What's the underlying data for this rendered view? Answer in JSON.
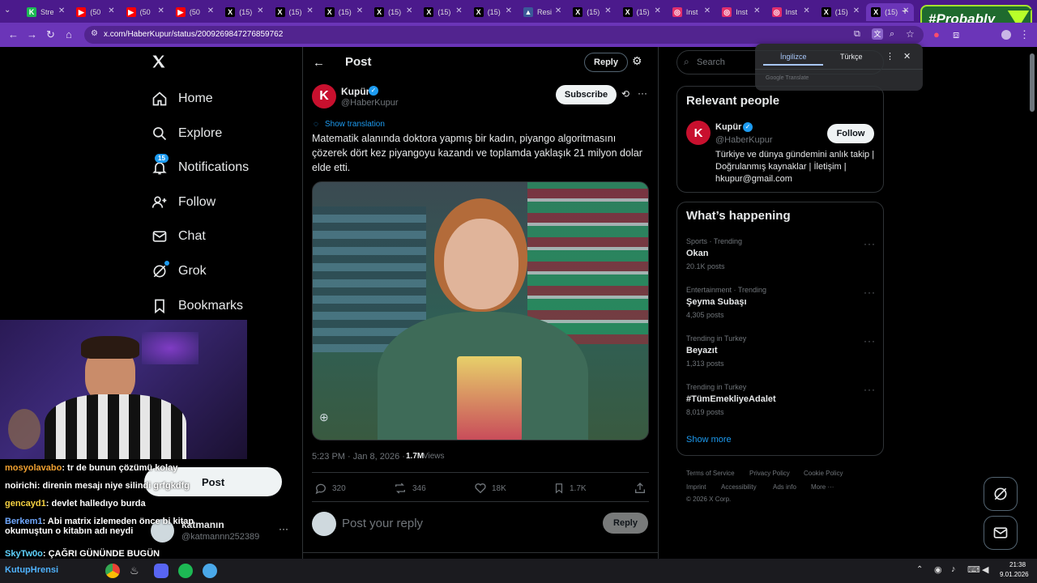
{
  "browser": {
    "tabs": [
      {
        "label": "Stre",
        "color": "#1db954",
        "glyph": "K"
      },
      {
        "label": "(50",
        "color": "#ff0000",
        "glyph": "▶"
      },
      {
        "label": "(50",
        "color": "#ff0000",
        "glyph": "▶"
      },
      {
        "label": "(50",
        "color": "#ff0000",
        "glyph": "▶"
      },
      {
        "label": "(15)",
        "color": "#000000",
        "glyph": "X"
      },
      {
        "label": "(15)",
        "color": "#000000",
        "glyph": "X"
      },
      {
        "label": "(15)",
        "color": "#000000",
        "glyph": "X"
      },
      {
        "label": "(15)",
        "color": "#000000",
        "glyph": "X"
      },
      {
        "label": "(15)",
        "color": "#000000",
        "glyph": "X"
      },
      {
        "label": "(15)",
        "color": "#000000",
        "glyph": "X"
      },
      {
        "label": "Resi",
        "color": "#3b5998",
        "glyph": "▲"
      },
      {
        "label": "(15)",
        "color": "#000000",
        "glyph": "X"
      },
      {
        "label": "(15)",
        "color": "#000000",
        "glyph": "X"
      },
      {
        "label": "Inst",
        "color": "#e1306c",
        "glyph": "◎"
      },
      {
        "label": "Inst",
        "color": "#e1306c",
        "glyph": "◎"
      },
      {
        "label": "Inst",
        "color": "#e1306c",
        "glyph": "◎"
      },
      {
        "label": "(15)",
        "color": "#000000",
        "glyph": "X"
      },
      {
        "label": "(15)",
        "color": "#000000",
        "glyph": "X"
      }
    ],
    "url": "x.com/HaberKupur/status/2009269847276859762",
    "overlay_tag": "#Probably"
  },
  "translate_popup": {
    "tab1": "İngilizce",
    "tab2": "Türkçe",
    "footer": "Google Translate"
  },
  "nav": {
    "home": "Home",
    "explore": "Explore",
    "notifications": "Notifications",
    "notif_count": "15",
    "follow": "Follow",
    "chat": "Chat",
    "grok": "Grok",
    "bookmarks": "Bookmarks",
    "post_button": "Post"
  },
  "account": {
    "name": "katmanın",
    "handle": "@katmannn252389"
  },
  "post": {
    "header_title": "Post",
    "header_reply": "Reply",
    "author_name": "Kupür",
    "author_handle": "@HaberKupur",
    "subscribe": "Subscribe",
    "show_translation": "Show translation",
    "text": "Matematik alanında doktora yapmış bir kadın, piyango algoritmasını çözerek dört kez piyangoyu kazandı ve toplamda yaklaşık 21 milyon dolar elde etti.",
    "timestamp": "5:23 PM · Jan 8, 2026 · ",
    "views_count": "1.7M",
    "views_label": " Views",
    "replies": "320",
    "reposts": "346",
    "likes": "18K",
    "bookmarks": "1.7K",
    "reply_placeholder": "Post your reply",
    "reply_button": "Reply"
  },
  "right": {
    "search_placeholder": "Search",
    "relevant_title": "Relevant people",
    "person_name": "Kupür",
    "person_handle": "@HaberKupur",
    "follow_button": "Follow",
    "person_bio": "Türkiye ve dünya gündemini anlık takip | Doğrulanmış kaynaklar | İletişim | hkupur@gmail.com",
    "happening_title": "What’s happening",
    "trends": [
      {
        "cat": "Sports · Trending",
        "name": "Okan",
        "count": "20.1K posts"
      },
      {
        "cat": "Entertainment · Trending",
        "name": "Şeyma Subaşı",
        "count": "4,305 posts"
      },
      {
        "cat": "Trending in Turkey",
        "name": "Beyazıt",
        "count": "1,313 posts"
      },
      {
        "cat": "Trending in Turkey",
        "name": "#TümEmekliyeAdalet",
        "count": "8,019 posts"
      }
    ],
    "show_more": "Show more",
    "footer_links": [
      "Terms of Service",
      "Privacy Policy",
      "Cookie Policy",
      "Imprint",
      "Accessibility",
      "Ads info",
      "More ···"
    ],
    "copyright": "© 2026 X Corp."
  },
  "chat_overlay": [
    {
      "user": "mosyolavabo",
      "color": "#f0a030",
      "msg": ": tr de bunun çözümü kolay"
    },
    {
      "user": "noirichi",
      "color": "#ffffff",
      "msg": ": direnin mesajı niye silindi grfgkdfg"
    },
    {
      "user": "gencayd1",
      "color": "#f5d142",
      "msg": ": devlet halledıyo burda"
    },
    {
      "user": "Berkem1",
      "color": "#6fa8ff",
      "msg": ": Abi matrix izlemeden önce bi kitap okumuştun o kitabın adı neydi"
    },
    {
      "user": "SkyTw0o",
      "color": "#5fd3ff",
      "msg": ": ÇAĞRI GÜNÜNDE BUGÜN"
    }
  ],
  "taskbar": {
    "overlay_text": "KutupHrensi",
    "time": "21:38",
    "date": "9.01.2026"
  }
}
